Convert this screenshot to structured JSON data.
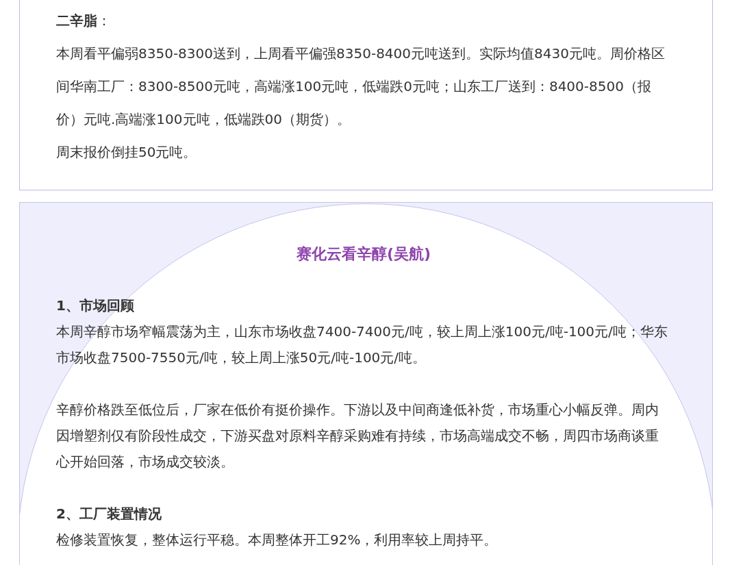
{
  "summary_card": {
    "heading": "**二辛脂**：",
    "paragraphs": [
      "本周看平偏弱8350-8300送到，上周看平偏强8350-8400元吨送到。实际均值8430元吨。周价格区间华南工厂：8300-8500元吨，高端涨100元吨，低端跌0元吨；山东工厂送到：8400-8500（报价）元吨.高端涨100元吨，低端跌00（期货）。",
      "周末报价倒挂50元吨。"
    ]
  },
  "report_card": {
    "title": "赛化云看辛醇(吴航)",
    "sections": [
      {
        "heading": "1、市场回顾",
        "paragraphs": [
          "本周辛醇市场窄幅震荡为主，山东市场收盘7400-7400元/吨，较上周上涨100元/吨-100元/吨；华东市场收盘7500-7550元/吨，较上周上涨50元/吨-100元/吨。",
          "辛醇价格跌至低位后，厂家在低价有挺价操作。下游以及中间商逢低补货，市场重心小幅反弹。周内因增塑剂仅有阶段性成交，下游买盘对原料辛醇采购难有持续，市场高端成交不畅，周四市场商谈重心开始回落，市场成交较淡。"
        ]
      },
      {
        "heading": "2、工厂装置情况",
        "paragraphs": [
          "检修装置恢复，整体运行平稳。本周整体开工92%，利用率较上周持平。"
        ]
      }
    ]
  }
}
